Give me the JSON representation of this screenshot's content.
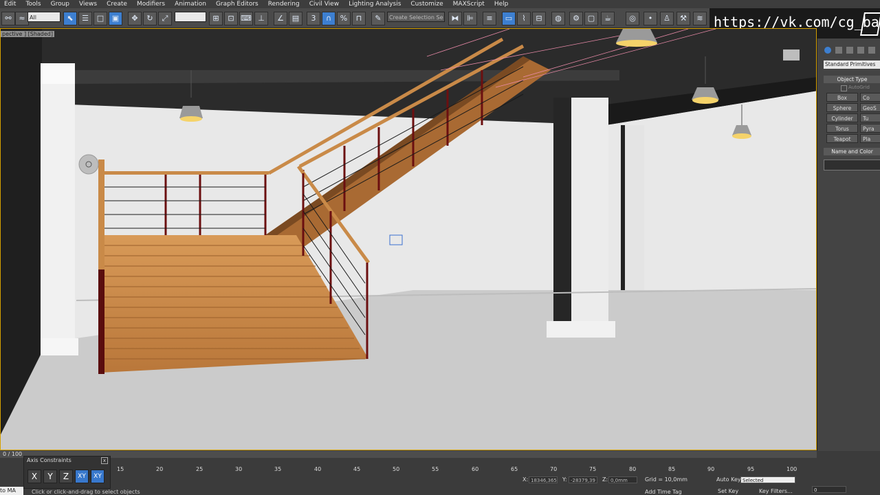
{
  "menu": [
    "Edit",
    "Tools",
    "Group",
    "Views",
    "Create",
    "Modifiers",
    "Animation",
    "Graph Editors",
    "Rendering",
    "Civil View",
    "Lighting Analysis",
    "Customize",
    "MAXScript",
    "Help"
  ],
  "toolbar": {
    "filter_select": "All",
    "selection_set": "Create Selection Se"
  },
  "brand": {
    "text": "https://vk.com/cg_bandit"
  },
  "viewport": {
    "label": "pective ] [Shaded]"
  },
  "command_panel": {
    "category": "Standard Primitives",
    "object_type_title": "Object Type",
    "autogrid_label": "AutoGrid",
    "buttons_left": [
      "Box",
      "Sphere",
      "Cylinder",
      "Torus",
      "Teapot"
    ],
    "buttons_right": [
      "Co",
      "GeoS",
      "Tu",
      "Pyra",
      "Pla"
    ],
    "name_color_title": "Name and Color"
  },
  "timeline": {
    "slider": "0 / 100",
    "ticks": [
      "15",
      "20",
      "25",
      "30",
      "35",
      "40",
      "45",
      "50",
      "55",
      "60",
      "65",
      "70",
      "75",
      "80",
      "85",
      "90",
      "95",
      "100"
    ]
  },
  "axis_constraints": {
    "title": "Axis Constraints",
    "close": "x",
    "buttons": [
      "X",
      "Y",
      "Z",
      "XY",
      "XY"
    ]
  },
  "status": {
    "script_stub": "to MA",
    "prompt": "Click or click-and-drag to select objects",
    "x_label": "X:",
    "x_value": "18346,365",
    "y_label": "Y:",
    "y_value": "-28379,39",
    "z_label": "Z:",
    "z_value": "0,0mm",
    "grid": "Grid = 10,0mm",
    "add_time_tag": "Add Time Tag",
    "auto_key": "Auto Key",
    "selected": "Selected",
    "set_key": "Set Key",
    "key_filters": "Key Filters...",
    "frame": "0"
  }
}
